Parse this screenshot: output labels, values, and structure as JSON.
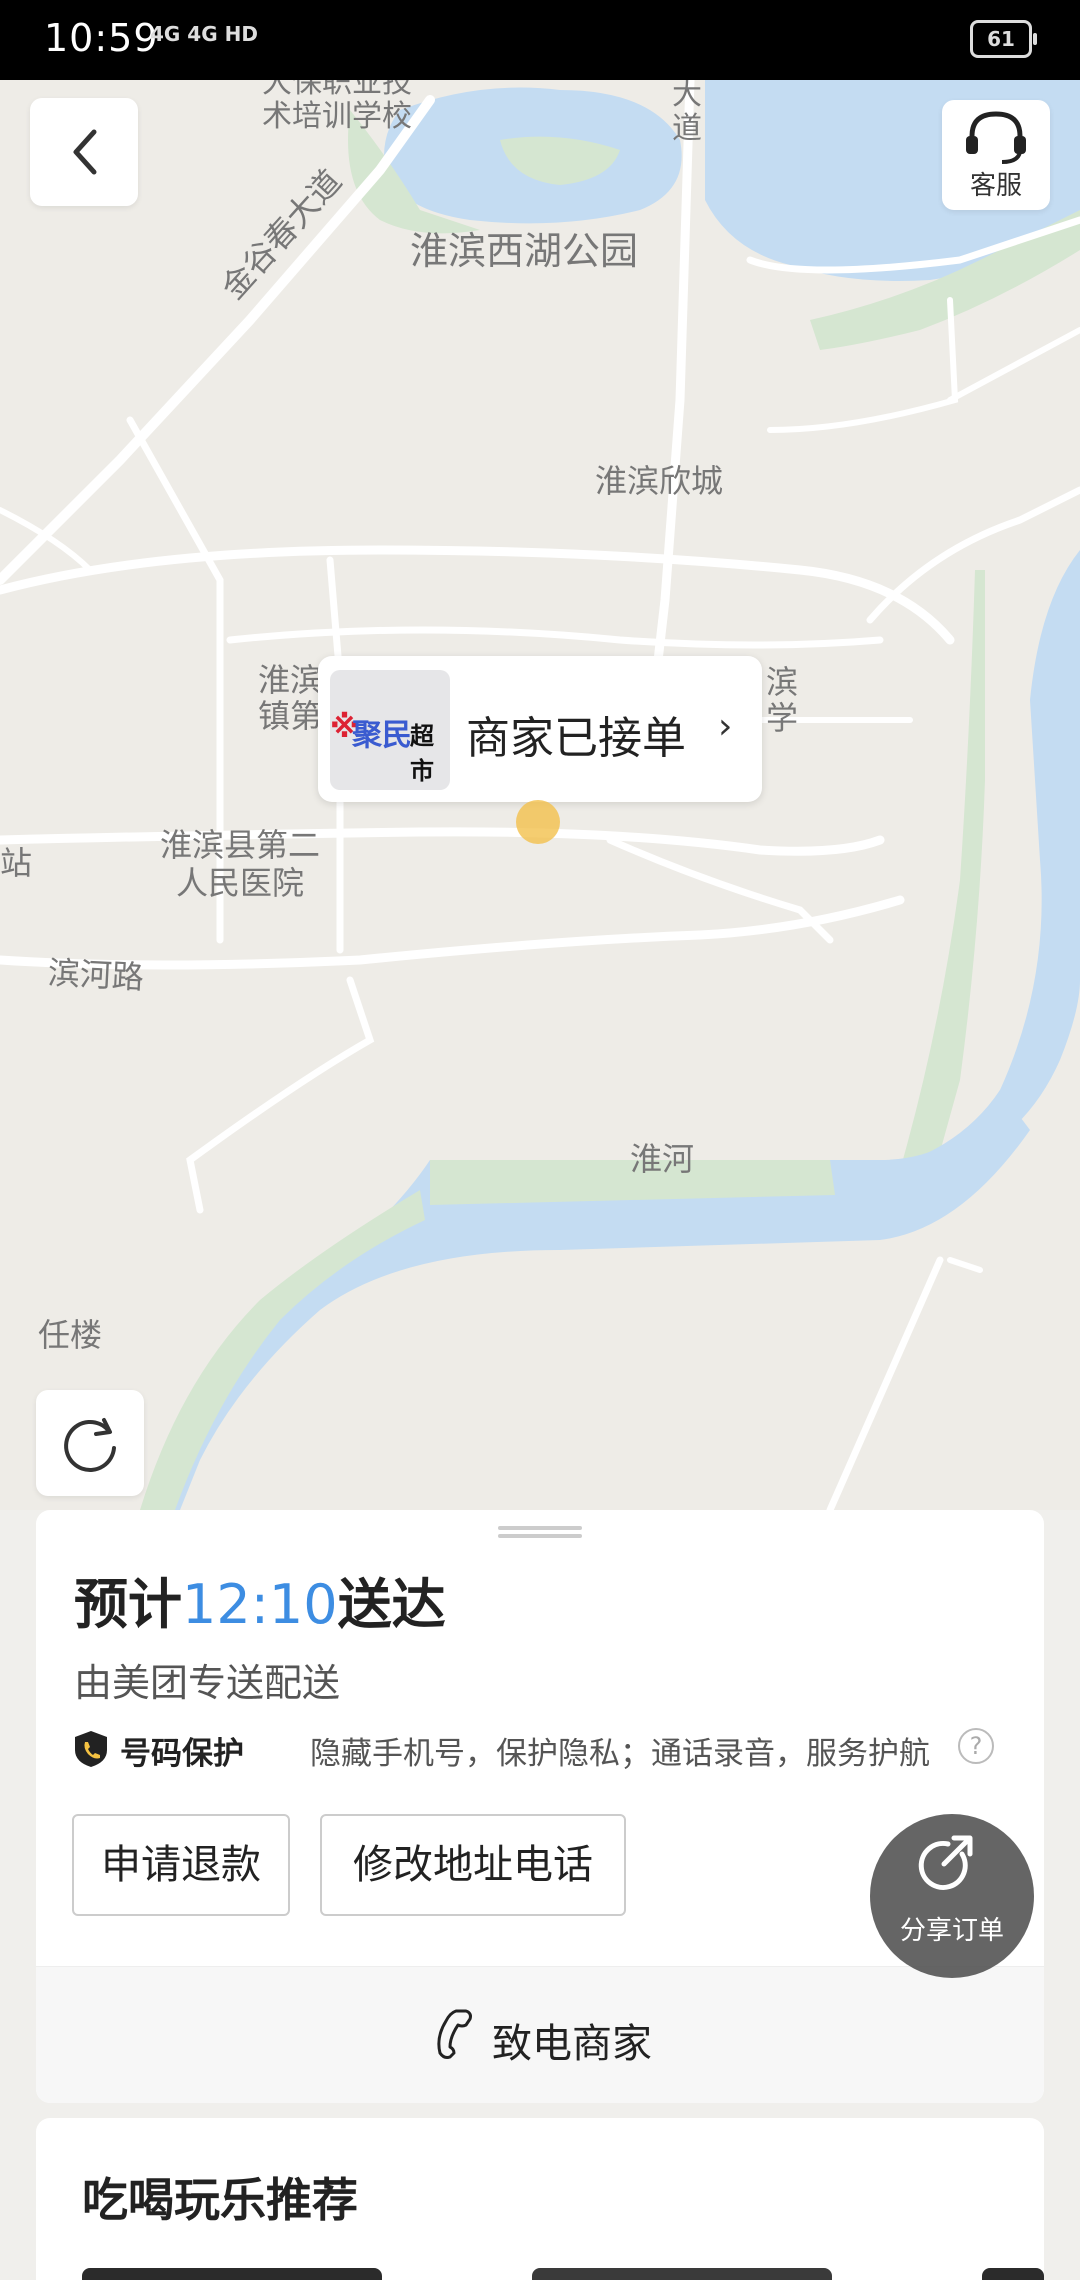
{
  "status_bar": {
    "time": "10:59",
    "signal": "4G 4G HD",
    "battery": "61"
  },
  "map": {
    "labels": {
      "school": "大保职业技\n术培训学校",
      "road_jingu": "金谷春大道",
      "road_da": "大\n道",
      "park": "淮滨西湖公园",
      "xincheng": "淮滨欣城",
      "town": "淮滨\n镇第",
      "school2": "滨\n学",
      "zhan": "站",
      "hospital": "淮滨县第二\n人民医院",
      "binhe_road": "滨河路",
      "huaihe": "淮河",
      "renlou": "任楼"
    }
  },
  "nav": {
    "back_icon": "chevron-left-icon",
    "customer_service_label": "客服"
  },
  "merchant_bubble": {
    "logo_text_red": "※",
    "logo_text_blue": "聚民",
    "logo_text_black": "超市",
    "status": "商家已接单",
    "chevron": "›"
  },
  "delivery": {
    "eta_prefix": "预计",
    "eta_time": "12:10",
    "eta_suffix": "送达",
    "courier": "由美团专送配送",
    "protection_title": "号码保护",
    "protection_desc": "隐藏手机号，保护隐私；通话录音，服务护航",
    "help": "?",
    "refund_button": "申请退款",
    "modify_button": "修改地址电话",
    "call_merchant": "致电商家"
  },
  "share": {
    "label": "分享订单"
  },
  "recommend": {
    "title": "吃喝玩乐推荐"
  },
  "colors": {
    "accent": "#3d8de2",
    "water": "#c4dcf2",
    "green": "#d5e6d1"
  }
}
